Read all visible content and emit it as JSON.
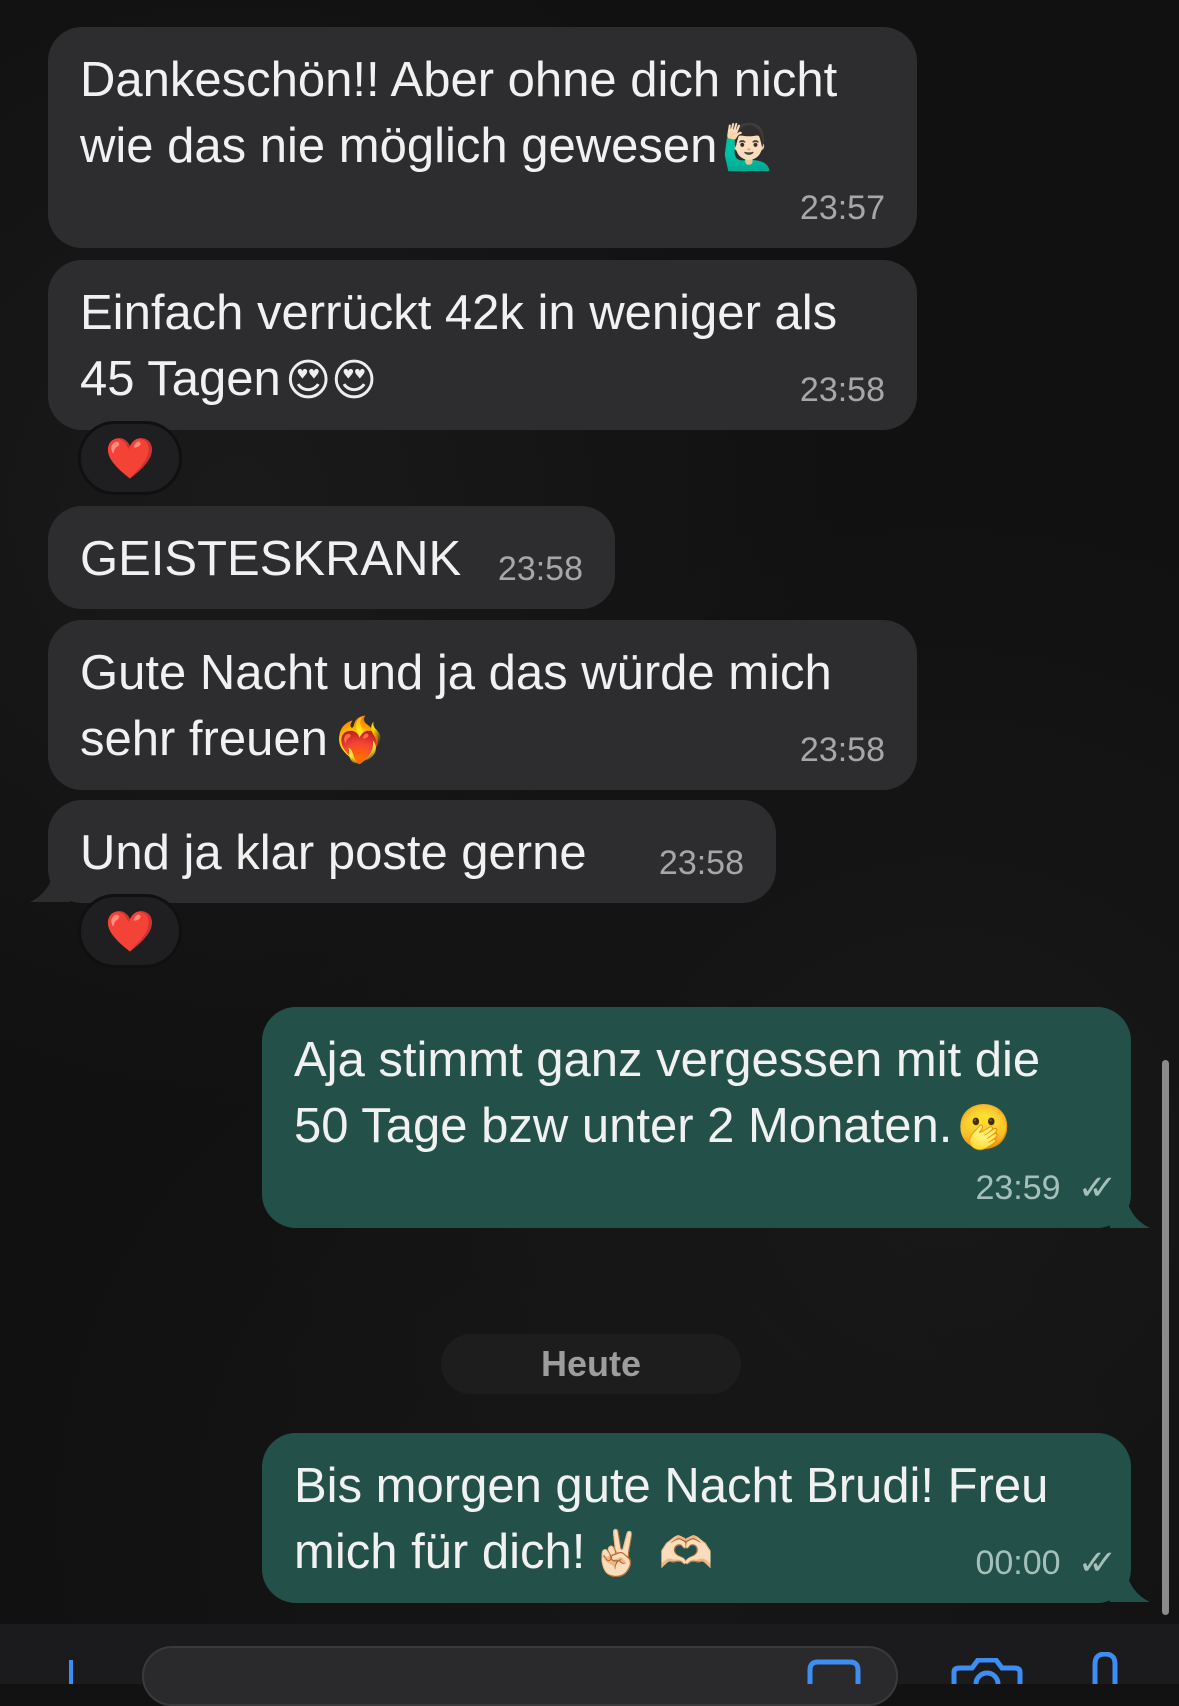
{
  "chat": {
    "messages": [
      {
        "direction": "incoming",
        "text": "Dankeschön!! Aber ohne dich nicht wie das nie möglich gewesen",
        "emoji": "🙋🏻‍♂️",
        "time": "23:57"
      },
      {
        "direction": "incoming",
        "text": "Einfach verrückt 42k in weniger als 45 Tagen",
        "emoji": "😍😍",
        "time": "23:58",
        "reaction": "❤️"
      },
      {
        "direction": "incoming",
        "text": "GEISTESKRANK",
        "emoji": "",
        "time": "23:58"
      },
      {
        "direction": "incoming",
        "text": "Gute Nacht und ja das würde mich sehr freuen",
        "emoji": "❤️‍🔥",
        "time": "23:58"
      },
      {
        "direction": "incoming",
        "text": "Und ja klar poste gerne",
        "emoji": "",
        "time": "23:58",
        "reaction": "❤️"
      },
      {
        "direction": "outgoing",
        "text": "Aja stimmt ganz vergessen mit die 50 Tage bzw unter 2 Monaten.",
        "emoji": "🫢",
        "time": "23:59",
        "status": "read"
      },
      {
        "direction": "outgoing",
        "text": "Bis morgen gute Nacht Brudi! Freu mich für dich!",
        "emoji": "✌🏻 🫶🏻",
        "time": "00:00",
        "status": "read"
      }
    ],
    "date_separator": "Heute"
  },
  "colors": {
    "incoming_bubble": "#2d2d2f",
    "outgoing_bubble": "#23514a",
    "background": "#121212",
    "reaction_heart": "#e8202e",
    "tick_color": "#a5bfb9"
  },
  "icons": {
    "tick": "double-check-icon",
    "reaction": "heart-icon"
  }
}
